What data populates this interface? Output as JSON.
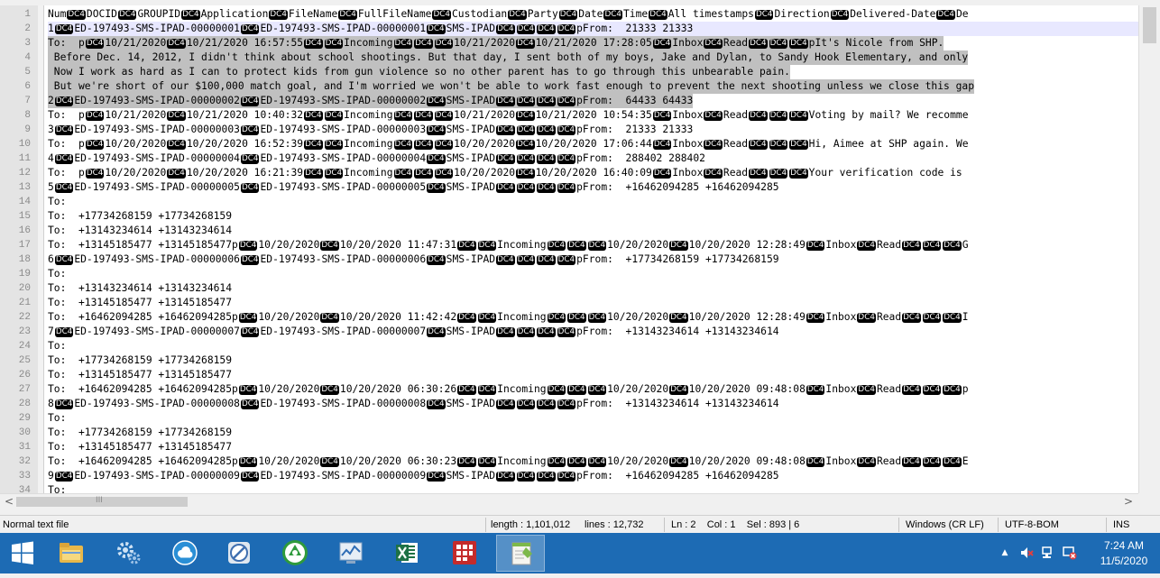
{
  "editor": {
    "sep": "DC4",
    "selected_lines": [
      2,
      3,
      4,
      5,
      6,
      7
    ],
    "current_line": 2,
    "lines": [
      {
        "n": "1",
        "t": "Num¦DOCID¦GROUPID¦Application¦FileName¦FullFileName¦Custodian¦Party¦Date¦Time¦All timestamps¦Direction¦Delivered-Date¦De"
      },
      {
        "n": "2",
        "t": "1¦ED-197493-SMS-IPAD-00000001¦ED-197493-SMS-IPAD-00000001¦SMS-IPAD¦¦¦¦pFrom:  21333 21333"
      },
      {
        "n": "3",
        "t": "To:  p¦10/21/2020¦10/21/2020 16:57:55¦¦Incoming¦¦¦10/21/2020¦10/21/2020 17:28:05¦Inbox¦Read¦¦¦pIt's Nicole from SHP."
      },
      {
        "n": "4",
        "t": " Before Dec. 14, 2012, I didn't think about school shootings. But that day, I sent both of my boys, Jake and Dylan, to Sandy Hook Elementary, and only"
      },
      {
        "n": "5",
        "t": " Now I work as hard as I can to protect kids from gun violence so no other parent has to go through this unbearable pain."
      },
      {
        "n": "6",
        "t": " But we're short of our $100,000 match goal, and I'm worried we won't be able to work fast enough to prevent the next shooting unless we close this gap"
      },
      {
        "n": "7",
        "t": "2¦ED-197493-SMS-IPAD-00000002¦ED-197493-SMS-IPAD-00000002¦SMS-IPAD¦¦¦¦pFrom:  64433 64433"
      },
      {
        "n": "8",
        "t": "To:  p¦10/21/2020¦10/21/2020 10:40:32¦¦Incoming¦¦¦10/21/2020¦10/21/2020 10:54:35¦Inbox¦Read¦¦¦Voting by mail? We recomme"
      },
      {
        "n": "9",
        "t": "3¦ED-197493-SMS-IPAD-00000003¦ED-197493-SMS-IPAD-00000003¦SMS-IPAD¦¦¦¦pFrom:  21333 21333"
      },
      {
        "n": "10",
        "t": "To:  p¦10/20/2020¦10/20/2020 16:52:39¦¦Incoming¦¦¦10/20/2020¦10/20/2020 17:06:44¦Inbox¦Read¦¦¦Hi, Aimee at SHP again. We"
      },
      {
        "n": "11",
        "t": "4¦ED-197493-SMS-IPAD-00000004¦ED-197493-SMS-IPAD-00000004¦SMS-IPAD¦¦¦¦pFrom:  288402 288402"
      },
      {
        "n": "12",
        "t": "To:  p¦10/20/2020¦10/20/2020 16:21:39¦¦Incoming¦¦¦10/20/2020¦10/20/2020 16:40:09¦Inbox¦Read¦¦¦Your verification code is"
      },
      {
        "n": "13",
        "t": "5¦ED-197493-SMS-IPAD-00000005¦ED-197493-SMS-IPAD-00000005¦SMS-IPAD¦¦¦¦pFrom:  +16462094285 +16462094285"
      },
      {
        "n": "14",
        "t": "To:"
      },
      {
        "n": "15",
        "t": "To:  +17734268159 +17734268159"
      },
      {
        "n": "16",
        "t": "To:  +13143234614 +13143234614"
      },
      {
        "n": "17",
        "t": "To:  +13145185477 +13145185477p¦10/20/2020¦10/20/2020 11:47:31¦¦Incoming¦¦¦10/20/2020¦10/20/2020 12:28:49¦Inbox¦Read¦¦¦G"
      },
      {
        "n": "18",
        "t": "6¦ED-197493-SMS-IPAD-00000006¦ED-197493-SMS-IPAD-00000006¦SMS-IPAD¦¦¦¦pFrom:  +17734268159 +17734268159"
      },
      {
        "n": "19",
        "t": "To:"
      },
      {
        "n": "20",
        "t": "To:  +13143234614 +13143234614"
      },
      {
        "n": "21",
        "t": "To:  +13145185477 +13145185477"
      },
      {
        "n": "22",
        "t": "To:  +16462094285 +16462094285p¦10/20/2020¦10/20/2020 11:42:42¦¦Incoming¦¦¦10/20/2020¦10/20/2020 12:28:49¦Inbox¦Read¦¦¦I"
      },
      {
        "n": "23",
        "t": "7¦ED-197493-SMS-IPAD-00000007¦ED-197493-SMS-IPAD-00000007¦SMS-IPAD¦¦¦¦pFrom:  +13143234614 +13143234614"
      },
      {
        "n": "24",
        "t": "To:"
      },
      {
        "n": "25",
        "t": "To:  +17734268159 +17734268159"
      },
      {
        "n": "26",
        "t": "To:  +13145185477 +13145185477"
      },
      {
        "n": "27",
        "t": "To:  +16462094285 +16462094285p¦10/20/2020¦10/20/2020 06:30:26¦¦Incoming¦¦¦10/20/2020¦10/20/2020 09:48:08¦Inbox¦Read¦¦¦p"
      },
      {
        "n": "28",
        "t": "8¦ED-197493-SMS-IPAD-00000008¦ED-197493-SMS-IPAD-00000008¦SMS-IPAD¦¦¦¦pFrom:  +13143234614 +13143234614"
      },
      {
        "n": "29",
        "t": "To:"
      },
      {
        "n": "30",
        "t": "To:  +17734268159 +17734268159"
      },
      {
        "n": "31",
        "t": "To:  +13145185477 +13145185477"
      },
      {
        "n": "32",
        "t": "To:  +16462094285 +16462094285p¦10/20/2020¦10/20/2020 06:30:23¦¦Incoming¦¦¦10/20/2020¦10/20/2020 09:48:08¦Inbox¦Read¦¦¦E"
      },
      {
        "n": "33",
        "t": "9¦ED-197493-SMS-IPAD-00000009¦ED-197493-SMS-IPAD-00000009¦SMS-IPAD¦¦¦¦pFrom:  +16462094285 +16462094285"
      },
      {
        "n": "34",
        "t": "To:"
      }
    ]
  },
  "hscroll": {
    "left_arrow": "<",
    "right_arrow": ">",
    "grip": "III"
  },
  "status": {
    "filetype": "Normal text file",
    "length": "length : 1,101,012",
    "lines": "lines : 12,732",
    "position": "Ln : 2    Col : 1    Sel : 893 | 6",
    "eol": "Windows (CR LF)",
    "encoding": "UTF-8-BOM",
    "mode": "INS"
  },
  "taskbar": {
    "apps": [
      {
        "name": "start-button-icon"
      },
      {
        "name": "file-explorer-icon"
      },
      {
        "name": "server-manager-icon"
      },
      {
        "name": "cloud-sync-icon"
      },
      {
        "name": "remote-desktop-icon"
      },
      {
        "name": "recycle-app-icon"
      },
      {
        "name": "task-manager-icon"
      },
      {
        "name": "excel-icon"
      },
      {
        "name": "grid-app-icon"
      },
      {
        "name": "notepad-plus-icon"
      }
    ],
    "tray_arrow": "▲",
    "time": "7:24 AM",
    "date": "11/5/2020",
    "accent": "#1d6bb4"
  }
}
